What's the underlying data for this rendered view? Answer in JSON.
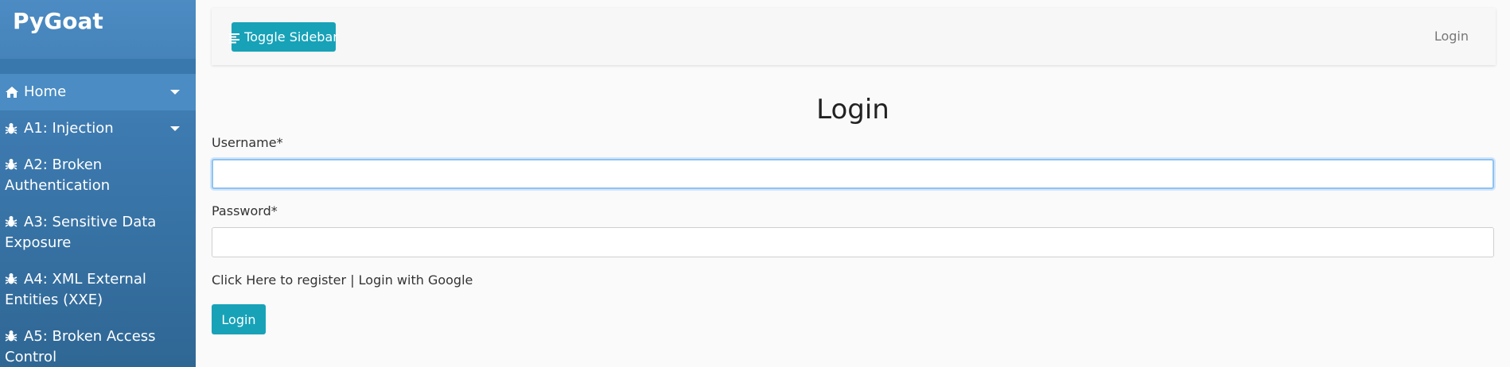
{
  "app": {
    "brand": "PyGoat"
  },
  "sidebar": {
    "items": [
      {
        "label": "Home",
        "icon": "home-icon",
        "has_caret": true
      },
      {
        "label": "A1: Injection",
        "icon": "bug-icon",
        "has_caret": true
      },
      {
        "label": "A2: Broken Authentication",
        "icon": "bug-icon",
        "has_caret": false
      },
      {
        "label": "A3: Sensitive Data Exposure",
        "icon": "bug-icon",
        "has_caret": false
      },
      {
        "label": "A4: XML External Entities (XXE)",
        "icon": "bug-icon",
        "has_caret": false
      },
      {
        "label": "A5: Broken Access Control",
        "icon": "bug-icon",
        "has_caret": false
      }
    ]
  },
  "topbar": {
    "toggle_label": "Toggle Sidebar",
    "login_link": "Login"
  },
  "form": {
    "title": "Login",
    "username_label": "Username*",
    "username_value": "",
    "password_label": "Password*",
    "password_value": "",
    "register_link": "Click Here to register",
    "separator": "|",
    "google_link": "Login with Google",
    "submit_label": "Login"
  },
  "colors": {
    "accent": "#17a2b8",
    "sidebar_top": "#4c8bc3",
    "sidebar_bottom": "#2f6794"
  }
}
